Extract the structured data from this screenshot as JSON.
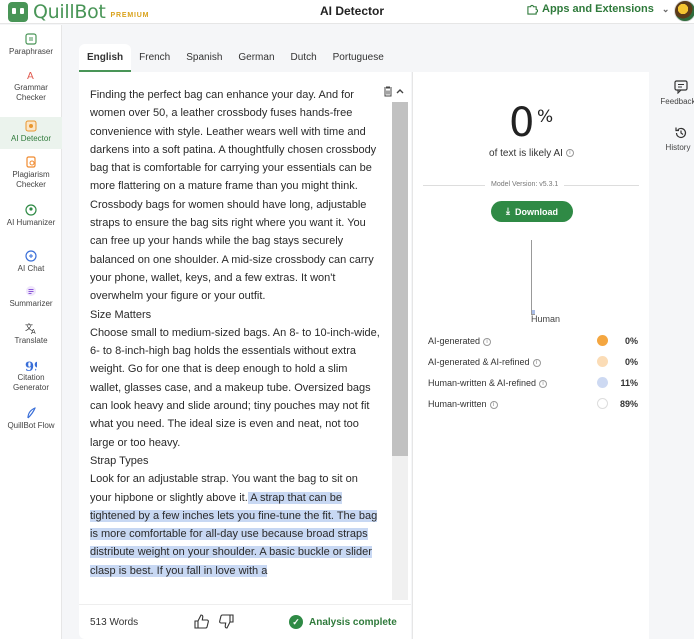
{
  "app": {
    "name": "QuillBot",
    "badge": "PREMIUM",
    "page_title": "AI Detector",
    "apps_label": "Apps and Extensions"
  },
  "sidebar": {
    "items": [
      {
        "label": "Paraphraser",
        "icon": "paraphraser-icon",
        "color": "#499557"
      },
      {
        "label": "Grammar Checker",
        "icon": "grammar-checker-icon",
        "color": "#e0584d"
      },
      {
        "label": "AI Detector",
        "icon": "ai-detector-icon",
        "color": "#e8962e",
        "active": true
      },
      {
        "label": "Plagiarism Checker",
        "icon": "plagiarism-checker-icon",
        "color": "#f08a2f"
      },
      {
        "label": "AI Humanizer",
        "icon": "ai-humanizer-icon",
        "color": "#2f8a45"
      },
      {
        "label": "AI Chat",
        "icon": "ai-chat-icon",
        "color": "#3a6fd8"
      },
      {
        "label": "Summarizer",
        "icon": "summarizer-icon",
        "color": "#8a56d8"
      },
      {
        "label": "Translate",
        "icon": "translate-icon",
        "color": "#333333"
      },
      {
        "label": "Citation Generator",
        "icon": "citation-generator-icon",
        "color": "#3a6fd8"
      },
      {
        "label": "QuillBot Flow",
        "icon": "quillbot-flow-icon",
        "color": "#3a6fd8"
      }
    ]
  },
  "tabs": [
    "English",
    "French",
    "Spanish",
    "German",
    "Dutch",
    "Portuguese"
  ],
  "editor": {
    "paragraphs": [
      {
        "text": "Finding the perfect bag can enhance your day. And for women over 50, a leather crossbody fuses hands-free convenience with style. Leather wears well with time and darkens into a soft patina. A thoughtfully chosen crossbody bag that is comfortable for carrying your essentials can be more flattering on a mature frame than you might think."
      },
      {
        "text": "Crossbody bags for women should have long, adjustable straps to ensure the bag sits right where you want it. You can free up your hands while the bag stays securely balanced on one shoulder. A mid-size crossbody can carry your phone, wallet, keys, and a few extras. It won't overwhelm your figure or your outfit."
      },
      {
        "text": "Size Matters"
      },
      {
        "text": "Choose small to medium-sized bags. An 8- to 10-inch-wide, 6- to 8-inch-high bag holds the essentials without extra weight. Go for one that is deep enough to hold a slim wallet, glasses case, and a makeup tube. Oversized bags can look heavy and slide around; tiny pouches may not fit what you need. The ideal size is even and neat, not too large or too heavy."
      },
      {
        "text": "Strap Types"
      },
      {
        "text": "Look for an adjustable strap. You want the bag to sit on your hipbone or slightly above it.",
        "highlighted": " A strap that can be tightened by a few inches lets you fine-tune the fit. The bag is more comfortable for all-day use because broad straps distribute weight on your shoulder. A basic buckle or slider clasp is best. If you fall in love with a"
      }
    ],
    "word_count": "513 Words",
    "status": "Analysis complete"
  },
  "results": {
    "score": "0",
    "score_unit": "%",
    "likely_text": "of text is likely AI",
    "model_version": "Model Version: v5.3.1",
    "download_label": "Download",
    "chart_label": "Human",
    "human_share": 0.89,
    "legend": [
      {
        "label": "AI-generated",
        "value": "0%",
        "color": "#f4a640"
      },
      {
        "label": "AI-generated & AI-refined",
        "value": "0%",
        "color": "#fbdcb6"
      },
      {
        "label": "Human-written & AI-refined",
        "value": "11%",
        "color": "#cdd9f2"
      },
      {
        "label": "Human-written",
        "value": "89%",
        "color": "#ffffff"
      }
    ]
  },
  "rail": {
    "feedback_label": "Feedback",
    "history_label": "History"
  }
}
